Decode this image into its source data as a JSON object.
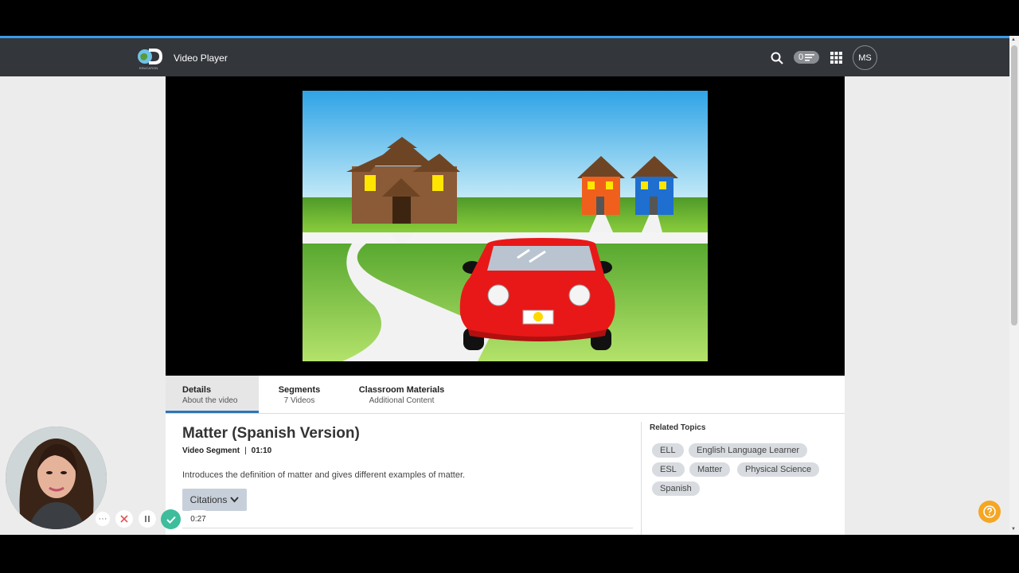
{
  "header": {
    "app_title": "Video Player",
    "logo_text": "EDUCATION",
    "playlist_count": "0",
    "avatar_initials": "MS"
  },
  "tabs": [
    {
      "label": "Details",
      "sublabel": "About the video",
      "active": true
    },
    {
      "label": "Segments",
      "sublabel": "7 Videos",
      "active": false
    },
    {
      "label": "Classroom Materials",
      "sublabel": "Additional Content",
      "active": false
    }
  ],
  "video": {
    "title": "Matter (Spanish Version)",
    "type": "Video Segment",
    "duration": "01:10",
    "description": "Introduces the definition of matter and gives different examples of matter.",
    "citations_label": "Citations"
  },
  "related_topics": {
    "heading": "Related Topics",
    "items": [
      "ELL",
      "English Language Learner",
      "ESL",
      "Matter",
      "Physical Science",
      "Spanish"
    ]
  },
  "recorder": {
    "more_label": "···",
    "elapsed": "0:27"
  },
  "colors": {
    "accent": "#3b9ae8",
    "topbar": "#33363b",
    "tab_underline": "#2f74b5",
    "help": "#f5a623",
    "chip": "#d8dbe0"
  }
}
